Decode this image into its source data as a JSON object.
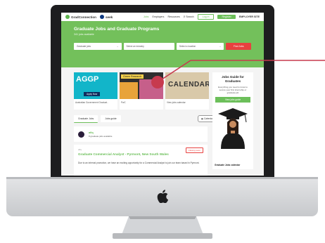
{
  "topbar": {
    "brand": "GradConnection",
    "partner": "seek",
    "nav": [
      "Jobs",
      "Employers",
      "Resources"
    ],
    "search": "Search",
    "login": "Log in",
    "register": "Register",
    "employer_site": "EMPLOYER SITE"
  },
  "hero": {
    "title": "Graduate Jobs and Graduate Programs",
    "subtitle": "341 jobs available",
    "filters": {
      "type": "Graduate jobs",
      "industry": "Select an industry",
      "location": "Select a location"
    },
    "find_button": "Find Jobs"
  },
  "cards": [
    {
      "label": "Australian Government Graduat..",
      "image": "AGGP",
      "badge": "Apply Now"
    },
    {
      "label": "PwC",
      "image": "Green Research"
    },
    {
      "label": "View jobs calendar",
      "image": "CALENDAR"
    }
  ],
  "sidebar": {
    "title": "Jobs Guide for Graduates",
    "text": "Everything you need to know to secure your first internship or graduate job",
    "button": "View jobs guide",
    "calendar_title": "Graduate Jobs calendar"
  },
  "tabs": {
    "jobs": "Graduate Jobs",
    "guide": "Jobs guide",
    "calendar_view": "Calendar View",
    "sort_by": "Sort by",
    "sort_value": "relevance"
  },
  "employer": {
    "name": "afiq",
    "count": "8 graduate jobs available"
  },
  "listing": {
    "company": "afiq",
    "title": "Graduate Commercial Analyst - Pyrmont, New South Wales",
    "button": "Closing soon",
    "description": "Due to an internal promotion, we have an exciting opportunity for a Commercial Analyst to join our team based in Pyrmont."
  },
  "colors": {
    "brand_green": "#73c05b",
    "accent_red": "#e8413f",
    "callout": "#c73a4e"
  }
}
